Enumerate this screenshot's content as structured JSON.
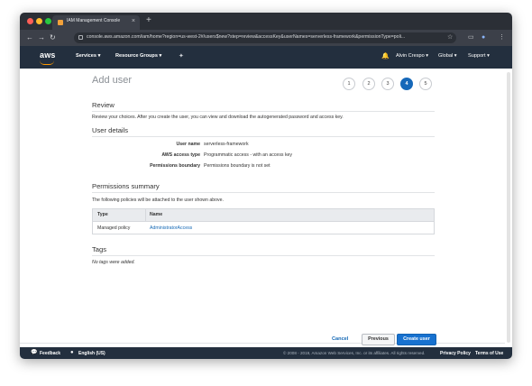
{
  "browser": {
    "tab_title": "IAM Management Console",
    "tab_close": "×",
    "new_tab": "+",
    "url": "console.aws.amazon.com/iam/home?region=us-west-2#/users$new?step=review&accessKey&userNames=serverless-framework&permissionType=poli...",
    "nav_icons": {
      "back": "←",
      "forward": "→",
      "reload": "↻"
    },
    "right_icons": {
      "star": "☆",
      "cast": "▭",
      "profile": "●",
      "menu": "⋮"
    },
    "traffic_colors": [
      "#ff5f57",
      "#febc2e",
      "#28c840"
    ]
  },
  "aws_nav": {
    "logo": "aws",
    "services": "Services ▾",
    "resource_groups": "Resource Groups ▾",
    "pin_icon": "✦",
    "bell_icon": "🔔",
    "user": "Alvin Crespo ▾",
    "region": "Global ▾",
    "support": "Support ▾"
  },
  "page": {
    "title": "Add user",
    "steps": [
      "1",
      "2",
      "3",
      "4",
      "5"
    ],
    "active_step": "4",
    "review": {
      "heading": "Review",
      "description": "Review your choices. After you create the user, you can view and download the autogenerated password and access key."
    },
    "user_details": {
      "heading": "User details",
      "rows": [
        {
          "label": "User name",
          "value": "serverless-framework"
        },
        {
          "label": "AWS access type",
          "value": "Programmatic access - with an access key"
        },
        {
          "label": "Permissions boundary",
          "value": "Permissions boundary is not set"
        }
      ]
    },
    "permissions": {
      "heading": "Permissions summary",
      "description": "The following policies will be attached to the user shown above.",
      "columns": [
        "Type",
        "Name"
      ],
      "rows": [
        {
          "type": "Managed policy",
          "name": "AdministratorAccess"
        }
      ]
    },
    "tags": {
      "heading": "Tags",
      "empty_text": "No tags were added."
    }
  },
  "actions": {
    "cancel": "Cancel",
    "previous": "Previous",
    "create": "Create user"
  },
  "footer": {
    "feedback_icon": "💬",
    "feedback": "Feedback",
    "globe_icon": "●",
    "language": "English (US)",
    "copyright": "© 2008 - 2019, Amazon Web Services, Inc. or its affiliates. All rights reserved.",
    "privacy": "Privacy Policy",
    "terms": "Terms of Use"
  }
}
